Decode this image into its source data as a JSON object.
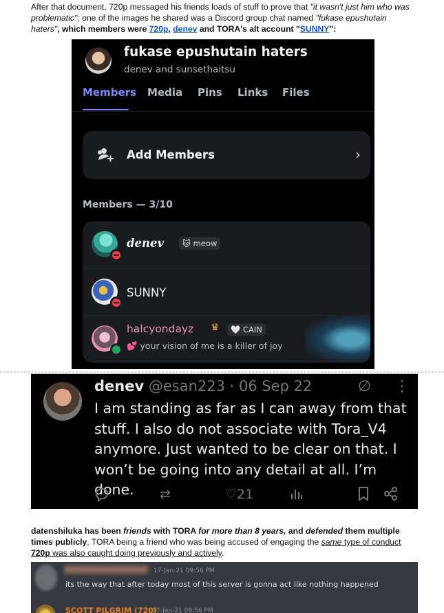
{
  "intro": {
    "t1": "After that document, 720p messaged his friends loads of stuff to prove that ",
    "quote1": "\"it wasn't just him who was problematic\"",
    "t2": "; one of the images he shared was a Discord group chat named ",
    "quote2": "\"fukase epushutain haters\"",
    "t3": ", which members were ",
    "link1": "720p",
    "t4": ", ",
    "link2": "denev",
    "t5": " and TORA's alt account \"",
    "link3": "SUNNY",
    "t6": "\":"
  },
  "discord": {
    "group_name": "fukase epushutain haters",
    "subtitle": "denev and sunsethaitsu",
    "tabs": [
      "Members",
      "Media",
      "Pins",
      "Links",
      "Files"
    ],
    "active_tab": "Members",
    "add_members_label": "Add Members",
    "members_header": "Members — 3/10",
    "members": [
      {
        "name": "denev",
        "tag": "🐱 meow",
        "status": "dnd"
      },
      {
        "name": "SUNNY",
        "status": "dnd"
      },
      {
        "name": "halcyondayz",
        "tag": "🤍 CAIN",
        "custom_status": "💕 your vision of me is a killer of joy",
        "status": "online"
      }
    ],
    "colors": {
      "accent": "#7b88f5",
      "dnd": "#f23f43",
      "online": "#23a55a",
      "halcyon_name": "#ef8fb9"
    }
  },
  "tweet": {
    "name": "denev",
    "handle_date": "@esan223 · 06 Sep 22",
    "body": "I am standing as far as I can away from that stuff. I also do not associate with Tora_V4 anymore. Just wanted to be clear on that. I won’t be going into any detail at all. I’m done.",
    "likes": "21",
    "icons": [
      "reply-icon",
      "retweet-icon",
      "heart-icon",
      "views-icon",
      "bookmark-icon",
      "share-icon",
      "grok-icon",
      "more-icon"
    ]
  },
  "para2": {
    "t1": "datenshiluka has been ",
    "em1": "friends",
    "t2": " with TORA ",
    "em2": "for more than 8 years,",
    "t3": " and ",
    "em3": "defended",
    "t4": " them multiple times publicly",
    "t5": ", TORA being a friend who was being accused of engaging the ",
    "em4": "same",
    "t6": " type of conduct ",
    "b1": "720p",
    "t7": " was also caught doing previously and actively",
    "t8": "."
  },
  "chat": {
    "time1": "17-Jan-21 09:56 PM",
    "message1": "its the way that after today most of this server is gonna act like nothing happened",
    "name2": "SCOTT PILGRIM (720)",
    "time2": "17-Jan-21 09:56 PM"
  }
}
